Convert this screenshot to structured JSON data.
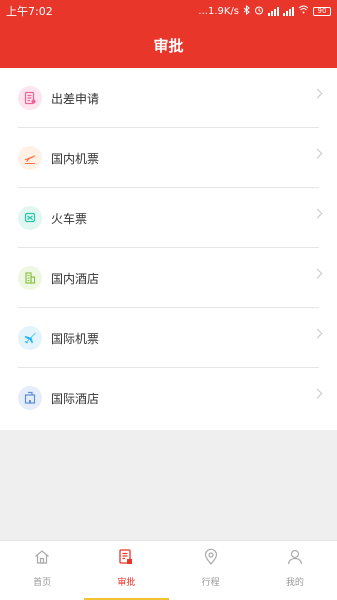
{
  "status_bar": {
    "time": "上午7:02",
    "network_speed": "...1.9K/s",
    "battery": "90"
  },
  "header": {
    "title": "审批"
  },
  "menu": {
    "items": [
      {
        "label": "出差申请",
        "icon": "document-icon",
        "color": "#f06292",
        "bg": "#fde4ee"
      },
      {
        "label": "国内机票",
        "icon": "plane-icon",
        "color": "#ff7043",
        "bg": "#fff1e6"
      },
      {
        "label": "火车票",
        "icon": "train-icon",
        "color": "#26c6a6",
        "bg": "#e2f7f2"
      },
      {
        "label": "国内酒店",
        "icon": "building-icon",
        "color": "#8bc34a",
        "bg": "#eef7e2"
      },
      {
        "label": "国际机票",
        "icon": "plane-icon",
        "color": "#29b6f6",
        "bg": "#e3f4fd"
      },
      {
        "label": "国际酒店",
        "icon": "building-icon",
        "color": "#5c8fd6",
        "bg": "#e4edf9"
      }
    ]
  },
  "tabbar": {
    "tabs": [
      {
        "label": "首页",
        "icon": "home-icon",
        "active": false
      },
      {
        "label": "审批",
        "icon": "approval-icon",
        "active": true
      },
      {
        "label": "行程",
        "icon": "location-icon",
        "active": false
      },
      {
        "label": "我的",
        "icon": "user-icon",
        "active": false
      }
    ]
  },
  "colors": {
    "brand_red": "#e8362b",
    "active_underline": "#f1c232"
  }
}
